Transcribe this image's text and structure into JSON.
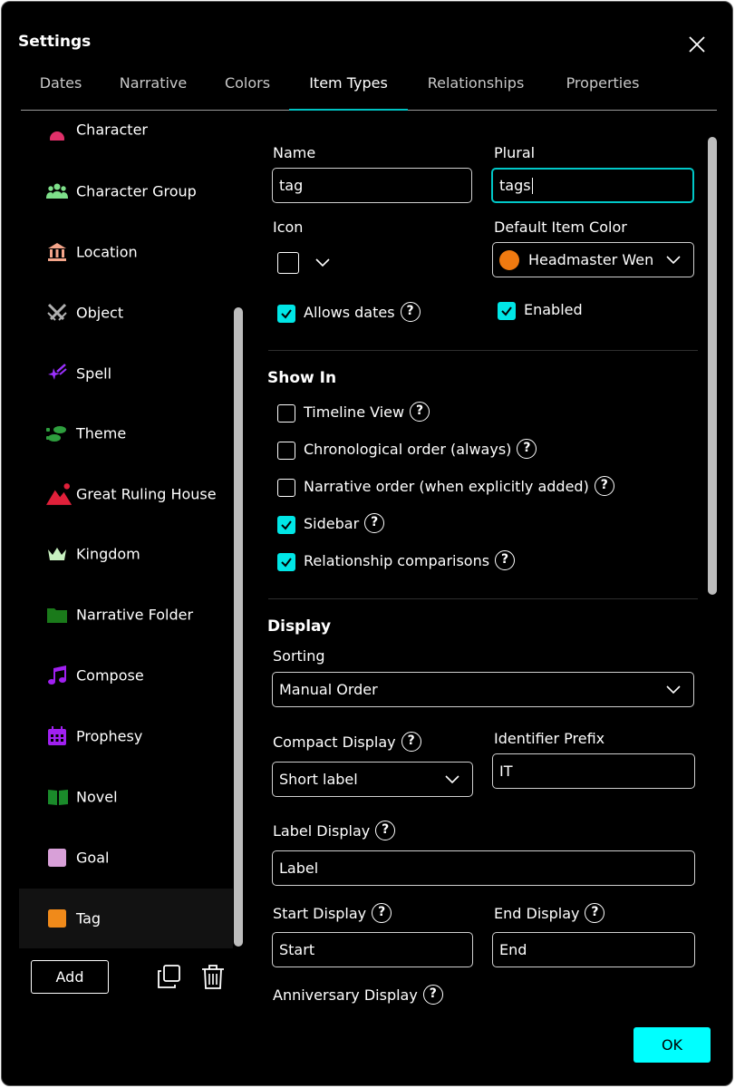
{
  "dialog": {
    "title": "Settings"
  },
  "tabs": [
    {
      "label": "Dates"
    },
    {
      "label": "Narrative"
    },
    {
      "label": "Colors"
    },
    {
      "label": "Item Types",
      "active": true
    },
    {
      "label": "Relationships"
    },
    {
      "label": "Properties"
    }
  ],
  "item_types": [
    {
      "label": "Character",
      "icon": "person-icon",
      "color": "#e0306a"
    },
    {
      "label": "Character Group",
      "icon": "group-icon",
      "color": "#7ee08a"
    },
    {
      "label": "Location",
      "icon": "building-icon",
      "color": "#f4a58a"
    },
    {
      "label": "Object",
      "icon": "crossed-swords-icon",
      "color": "#b0b0b0"
    },
    {
      "label": "Spell",
      "icon": "sparkle-wand-icon",
      "color": "#9b30ff"
    },
    {
      "label": "Theme",
      "icon": "footprints-icon",
      "color": "#2e9e3e"
    },
    {
      "label": "Great Ruling House",
      "icon": "mountain-icon",
      "color": "#e0203a"
    },
    {
      "label": "Kingdom",
      "icon": "crown-icon",
      "color": "#c8f0c0"
    },
    {
      "label": "Narrative Folder",
      "icon": "folder-icon",
      "color": "#1a7a1a"
    },
    {
      "label": "Compose",
      "icon": "music-note-icon",
      "color": "#a020f0"
    },
    {
      "label": "Prophesy",
      "icon": "calendar-icon",
      "color": "#a020f0"
    },
    {
      "label": "Novel",
      "icon": "open-book-icon",
      "color": "#1a8a2a"
    },
    {
      "label": "Goal",
      "icon": "square-icon",
      "color": "#d8a0d8"
    },
    {
      "label": "Tag",
      "icon": "square-icon",
      "color": "#f08a1a",
      "selected": true
    }
  ],
  "buttons": {
    "add": "Add",
    "ok": "OK"
  },
  "form": {
    "name_label": "Name",
    "name_value": "tag",
    "plural_label": "Plural",
    "plural_value": "tags",
    "icon_label": "Icon",
    "default_color_label": "Default Item Color",
    "default_color_value": "Headmaster Wen",
    "default_color_swatch": "#f07a10",
    "allows_dates_label": "Allows dates",
    "allows_dates_checked": true,
    "enabled_label": "Enabled",
    "enabled_checked": true
  },
  "show_in": {
    "heading": "Show In",
    "options": [
      {
        "label": "Timeline View",
        "checked": false
      },
      {
        "label": "Chronological order (always)",
        "checked": false
      },
      {
        "label": "Narrative order (when explicitly added)",
        "checked": false
      },
      {
        "label": "Sidebar",
        "checked": true
      },
      {
        "label": "Relationship comparisons",
        "checked": true
      }
    ]
  },
  "display": {
    "heading": "Display",
    "sorting_label": "Sorting",
    "sorting_value": "Manual Order",
    "compact_label": "Compact Display",
    "compact_value": "Short label",
    "prefix_label": "Identifier Prefix",
    "prefix_value": "IT",
    "label_display_label": "Label Display",
    "label_display_value": "Label",
    "start_label": "Start Display",
    "start_value": "Start",
    "end_label": "End Display",
    "end_value": "End",
    "anniversary_label": "Anniversary Display"
  },
  "colors": {
    "accent": "#00ffff",
    "background": "#000000",
    "text": "#ffffff"
  }
}
